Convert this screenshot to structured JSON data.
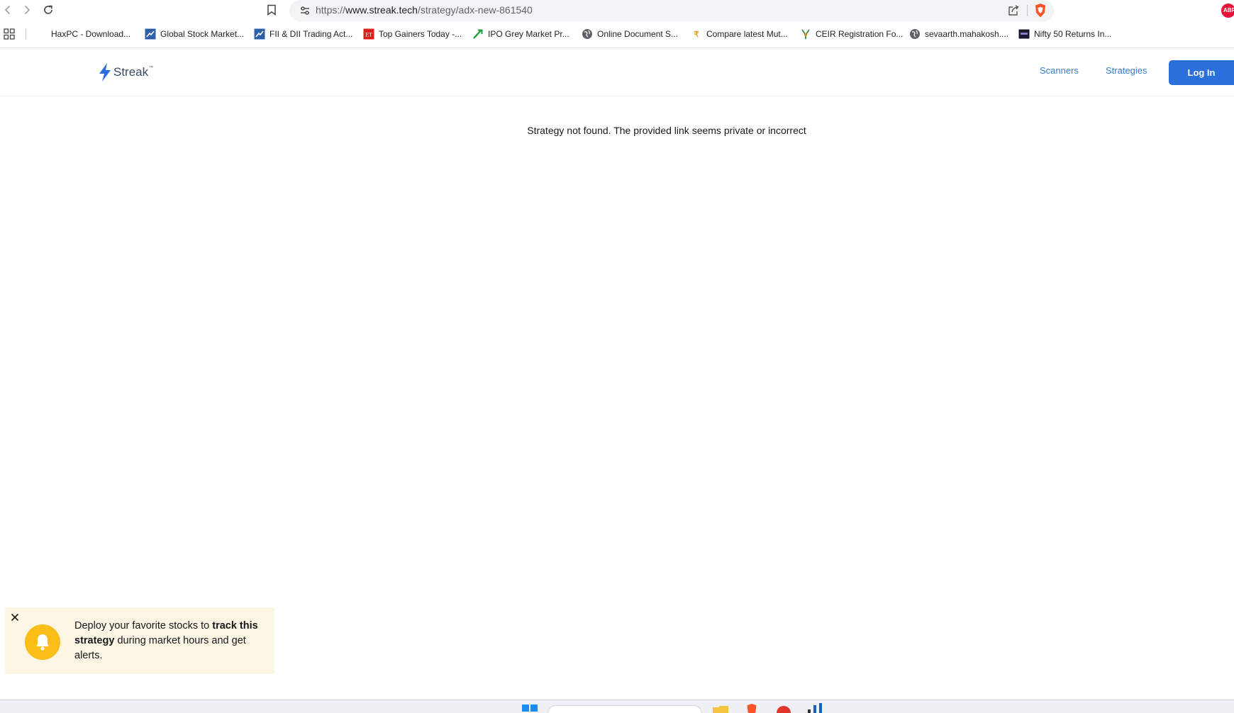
{
  "browser": {
    "url_prefix": "https://",
    "url_host": "www.streak.tech",
    "url_path": "/strategy/adx-new-861540",
    "extension_badge": "ABP"
  },
  "bookmarks": [
    {
      "label": "HaxPC - Download...",
      "icon": "none"
    },
    {
      "label": "Global Stock Market...",
      "icon": "chart-favicon"
    },
    {
      "label": "FII & DII Trading Act...",
      "icon": "chart-favicon"
    },
    {
      "label": "Top Gainers Today -...",
      "icon": "et-favicon"
    },
    {
      "label": "IPO Grey Market Pr...",
      "icon": "arrow-favicon"
    },
    {
      "label": "Online Document S...",
      "icon": "globe-icon"
    },
    {
      "label": "Compare latest Mut...",
      "icon": "coin-favicon"
    },
    {
      "label": "CEIR Registration Fo...",
      "icon": "emblem-favicon"
    },
    {
      "label": "sevaarth.mahakosh....",
      "icon": "globe-icon"
    },
    {
      "label": "Nifty 50 Returns In...",
      "icon": "dark-favicon"
    }
  ],
  "site": {
    "brand": "Streak",
    "brand_tm": "™",
    "nav": {
      "scanners": "Scanners",
      "strategies": "Strategies",
      "login": "Log In"
    },
    "colors": {
      "link": "#387ed1",
      "primary_button": "#2a6fdb",
      "bell": "#fbbd18",
      "toast_bg": "#fdf6e4"
    }
  },
  "main": {
    "message": "Strategy not found. The provided link seems private or incorrect"
  },
  "toast": {
    "text_before": "Deploy your favorite stocks to ",
    "text_bold": "track this strategy",
    "text_after": " during market hours and get alerts."
  }
}
